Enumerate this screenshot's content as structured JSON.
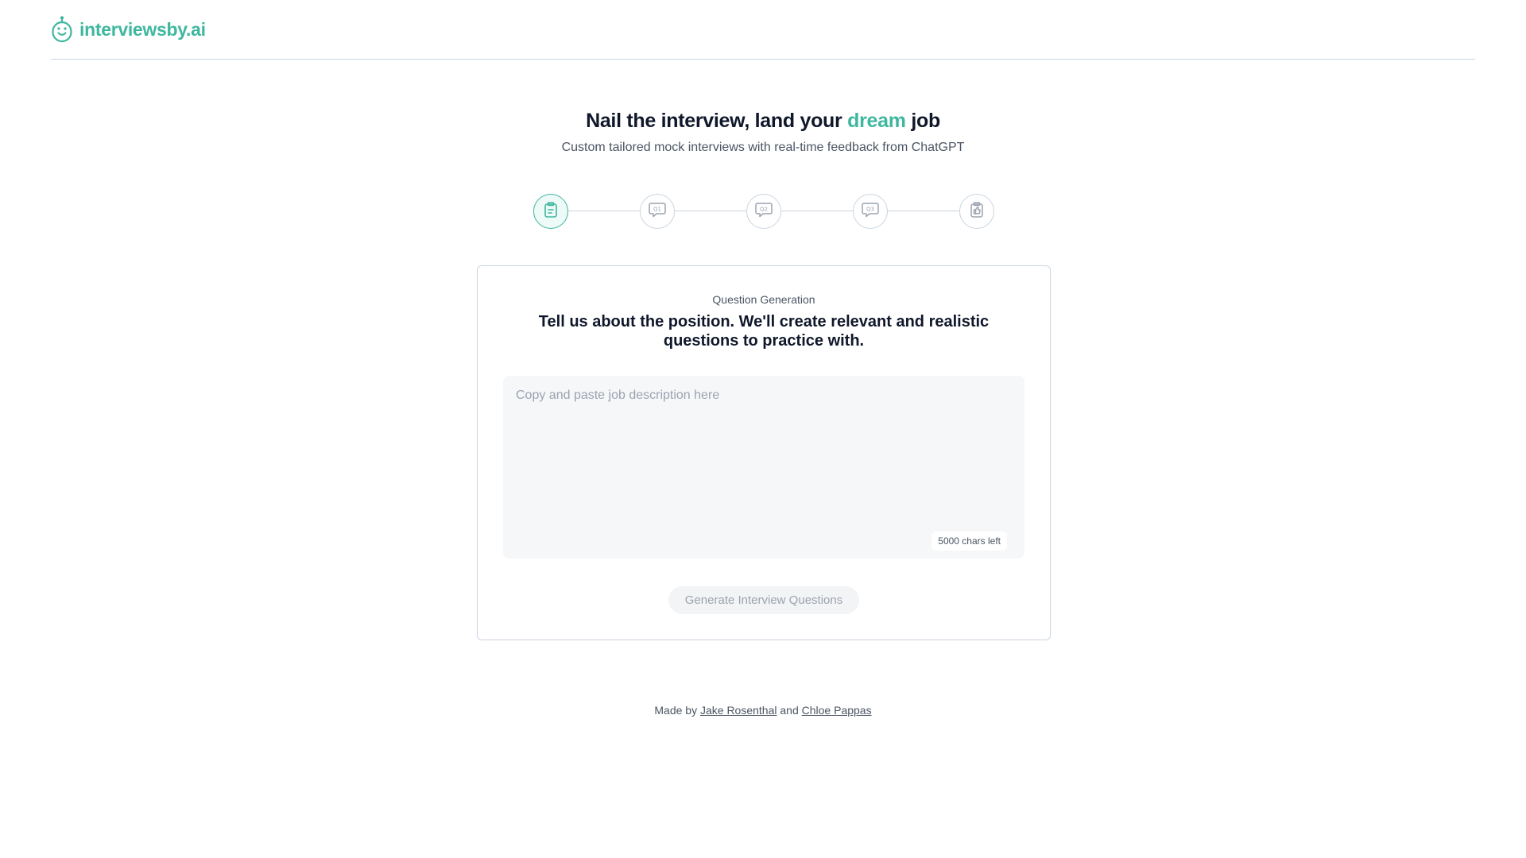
{
  "brand": {
    "name": "interviewsby.ai",
    "accent_color": "#3fb79f",
    "logo_icon": "robot-head-icon"
  },
  "hero": {
    "title_before": "Nail the interview, land your",
    "title_accent": "dream",
    "title_after": "job",
    "subtitle": "Custom tailored mock interviews with real-time feedback from ChatGPT"
  },
  "stepper": {
    "current_step": 1,
    "total_steps": 5,
    "steps": [
      {
        "icon": "clipboard-icon",
        "label": ""
      },
      {
        "icon": "speech-bubble-q1-icon",
        "label": "Q1"
      },
      {
        "icon": "speech-bubble-q2-icon",
        "label": "Q2"
      },
      {
        "icon": "speech-bubble-q3-icon",
        "label": "Q3"
      },
      {
        "icon": "clipboard-thumbs-up-icon",
        "label": ""
      }
    ]
  },
  "card": {
    "kicker": "Question Generation",
    "title": "Tell us about the position. We'll create relevant and realistic questions to practice with.",
    "textarea": {
      "value": "",
      "placeholder": "Copy and paste job description here"
    },
    "chars_left": "5000 chars left",
    "button_label": "Generate Interview Questions"
  },
  "footer": {
    "prefix": "Made by",
    "author1": "Jake Rosenthal",
    "joiner": "and",
    "author2": "Chloe Pappas"
  }
}
